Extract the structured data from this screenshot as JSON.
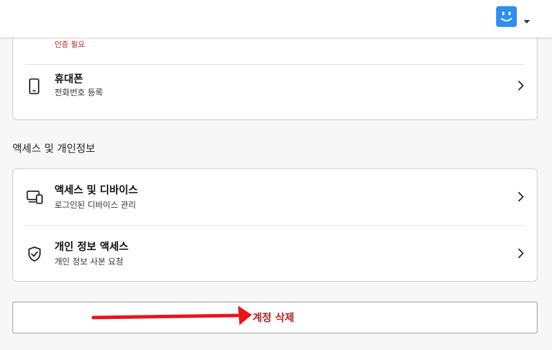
{
  "header": {
    "avatar_icon": "smiley-avatar-icon",
    "avatar_color": "#2d8ff0",
    "menu_icon": "caret-down-icon"
  },
  "security_card": {
    "verification_notice": "인증 필요",
    "phone": {
      "title": "휴대폰",
      "subtitle": "전화번호 등록",
      "icon": "smartphone-icon"
    }
  },
  "access_section": {
    "title": "액세스 및 개인정보",
    "items": [
      {
        "title": "액세스 및 디바이스",
        "subtitle": "로그인된 디바이스 관리",
        "icon": "devices-icon"
      },
      {
        "title": "개인 정보 액세스",
        "subtitle": "개인 정보 사본 요청",
        "icon": "shield-check-icon"
      }
    ]
  },
  "delete_account": {
    "label": "계정 삭제",
    "color": "#b3261e"
  },
  "annotation": {
    "arrow_color": "#e8141c"
  }
}
